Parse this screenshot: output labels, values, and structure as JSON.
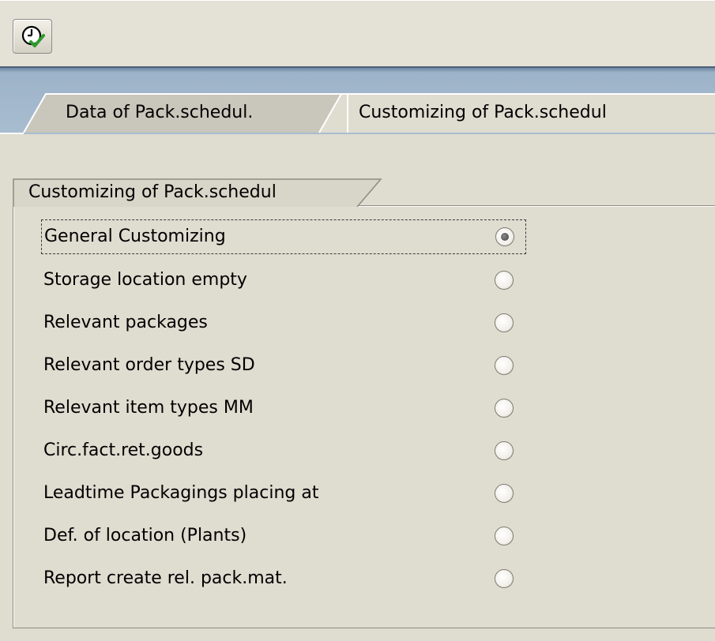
{
  "toolbar": {
    "execute_icon": "clock-checkmark-icon"
  },
  "tabs": [
    {
      "label": "Data of Pack.schedul.",
      "active": false
    },
    {
      "label": "Customizing of Pack.schedul",
      "active": true
    }
  ],
  "group": {
    "title": "Customizing of Pack.schedul",
    "options": [
      {
        "label": "General Customizing",
        "selected": true
      },
      {
        "label": "Storage location empty",
        "selected": false
      },
      {
        "label": "Relevant packages",
        "selected": false
      },
      {
        "label": "Relevant order types SD",
        "selected": false
      },
      {
        "label": "Relevant item types MM",
        "selected": false
      },
      {
        "label": "Circ.fact.ret.goods",
        "selected": false
      },
      {
        "label": "Leadtime Packagings placing at",
        "selected": false
      },
      {
        "label": "Def. of location (Plants)",
        "selected": false
      },
      {
        "label": "Report create rel. pack.mat.",
        "selected": false
      }
    ]
  },
  "colors": {
    "background": "#dfdcd0",
    "band_blue": "#a9bdd0",
    "check_green": "#3aa83a"
  }
}
